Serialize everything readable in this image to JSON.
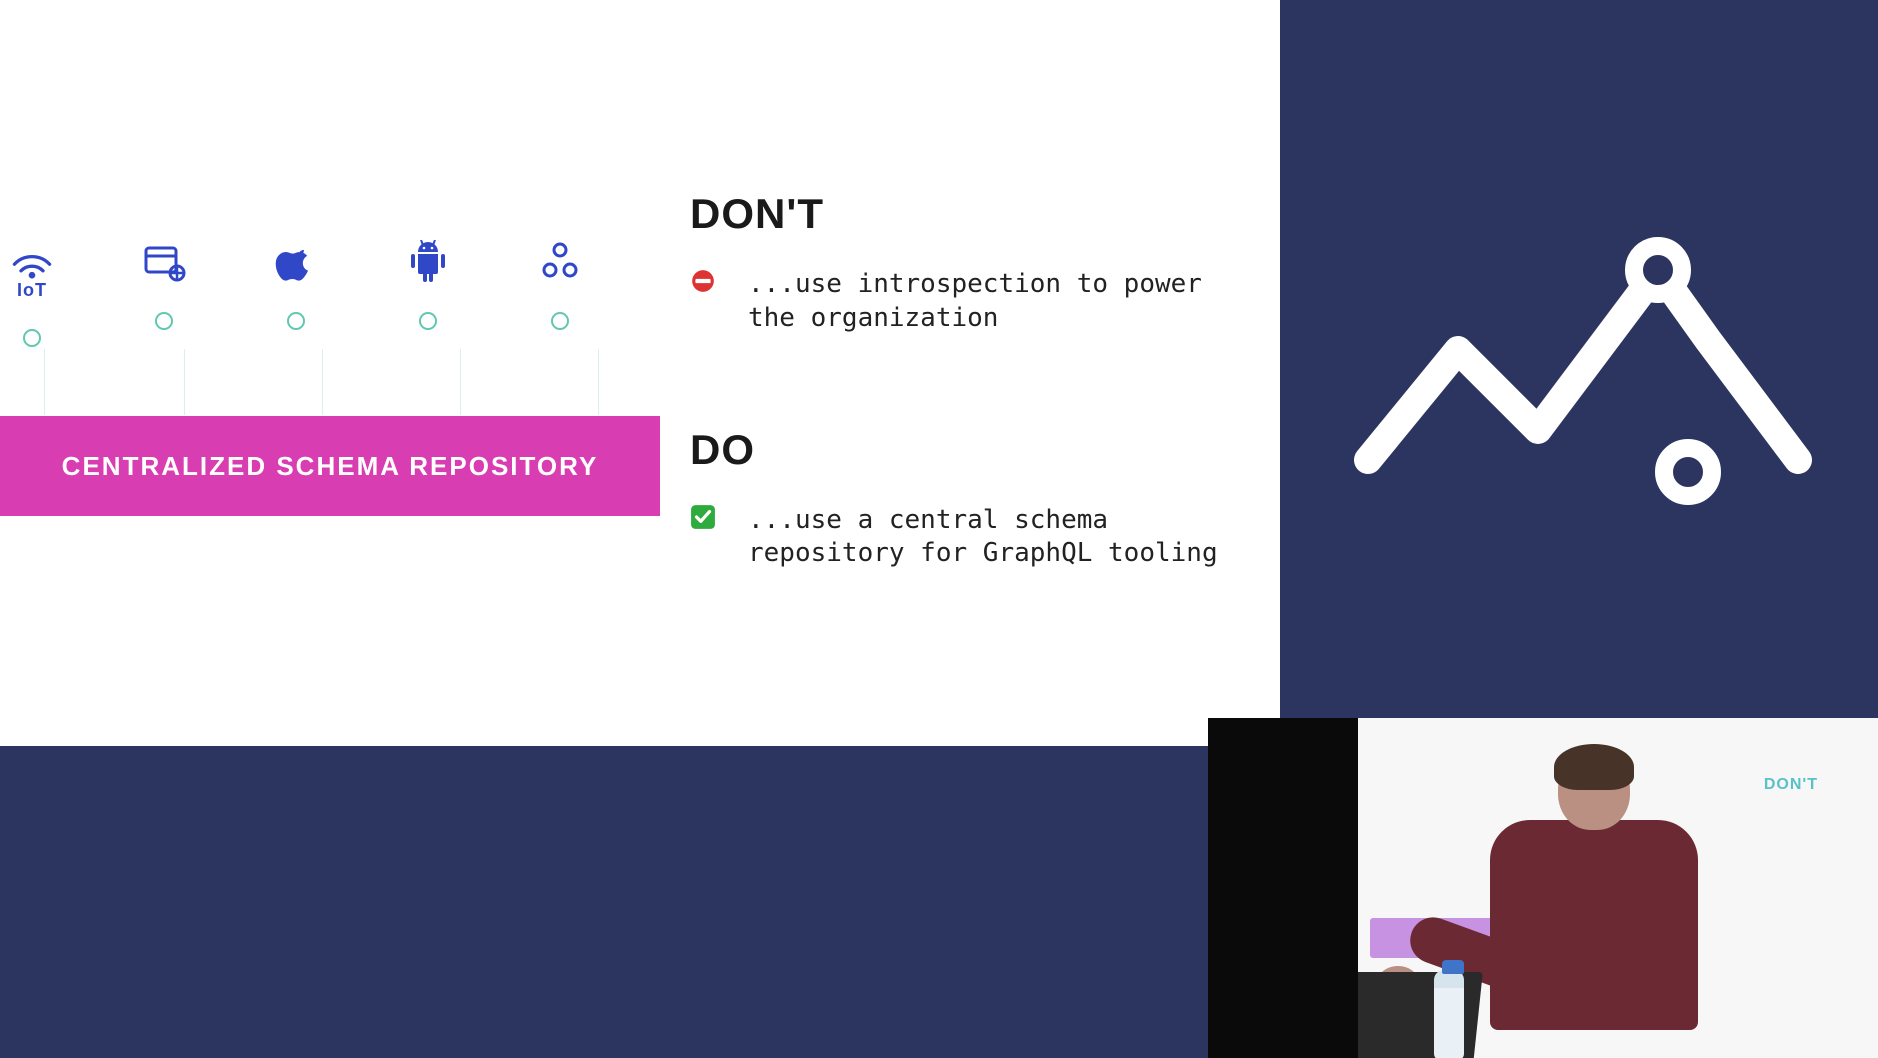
{
  "slide": {
    "repo_label": "CENTRALIZED SCHEMA REPOSITORY",
    "dont": {
      "heading": "DON'T",
      "text": "...use introspection to power the organization"
    },
    "do": {
      "heading": "DO",
      "text": "...use a central schema repository for GraphQL tooling"
    },
    "icons": [
      "iot",
      "web",
      "apple",
      "android",
      "cluster"
    ],
    "iot_label": "IoT"
  },
  "speaker": {
    "proj_dont": "DON'T"
  },
  "colors": {
    "bg": "#2c3560",
    "accent": "#d93db2",
    "icon_blue": "#3047c8",
    "ring": "#60c7b0"
  }
}
